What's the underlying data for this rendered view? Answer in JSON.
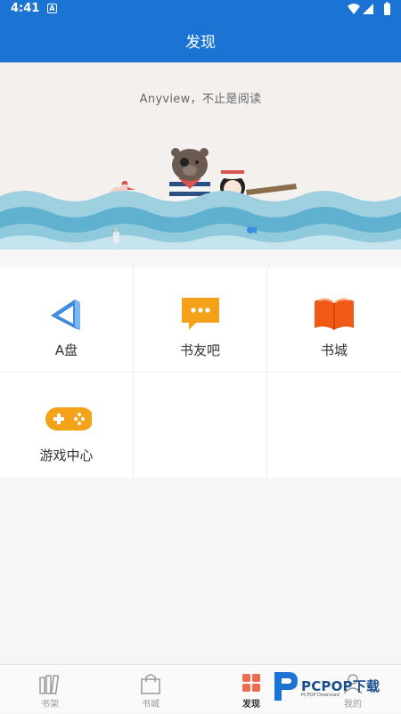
{
  "status_bar": {
    "time": "4:41",
    "badge": "A"
  },
  "app_bar": {
    "title": "发现"
  },
  "banner": {
    "slogan": "Anyview，不止是阅读"
  },
  "features": [
    {
      "label": "A盘",
      "icon": "a-disk-icon"
    },
    {
      "label": "书友吧",
      "icon": "chat-bubble-icon"
    },
    {
      "label": "书城",
      "icon": "open-book-icon"
    },
    {
      "label": "游戏中心",
      "icon": "gamepad-icon"
    }
  ],
  "tabs": [
    {
      "label": "书架",
      "icon": "bookshelf-icon",
      "active": false
    },
    {
      "label": "书城",
      "icon": "shopping-bag-icon",
      "active": false
    },
    {
      "label": "发现",
      "icon": "discover-grid-icon",
      "active": true
    },
    {
      "label": "我的",
      "icon": "person-icon",
      "active": false
    }
  ],
  "watermark": {
    "text": "PCPOP下载",
    "sub": "PCPOP Download"
  },
  "colors": {
    "primary": "#1b74d3",
    "orange": "#f5a21b",
    "book_red": "#f05a14",
    "disk_blue": "#3d8ee0"
  }
}
